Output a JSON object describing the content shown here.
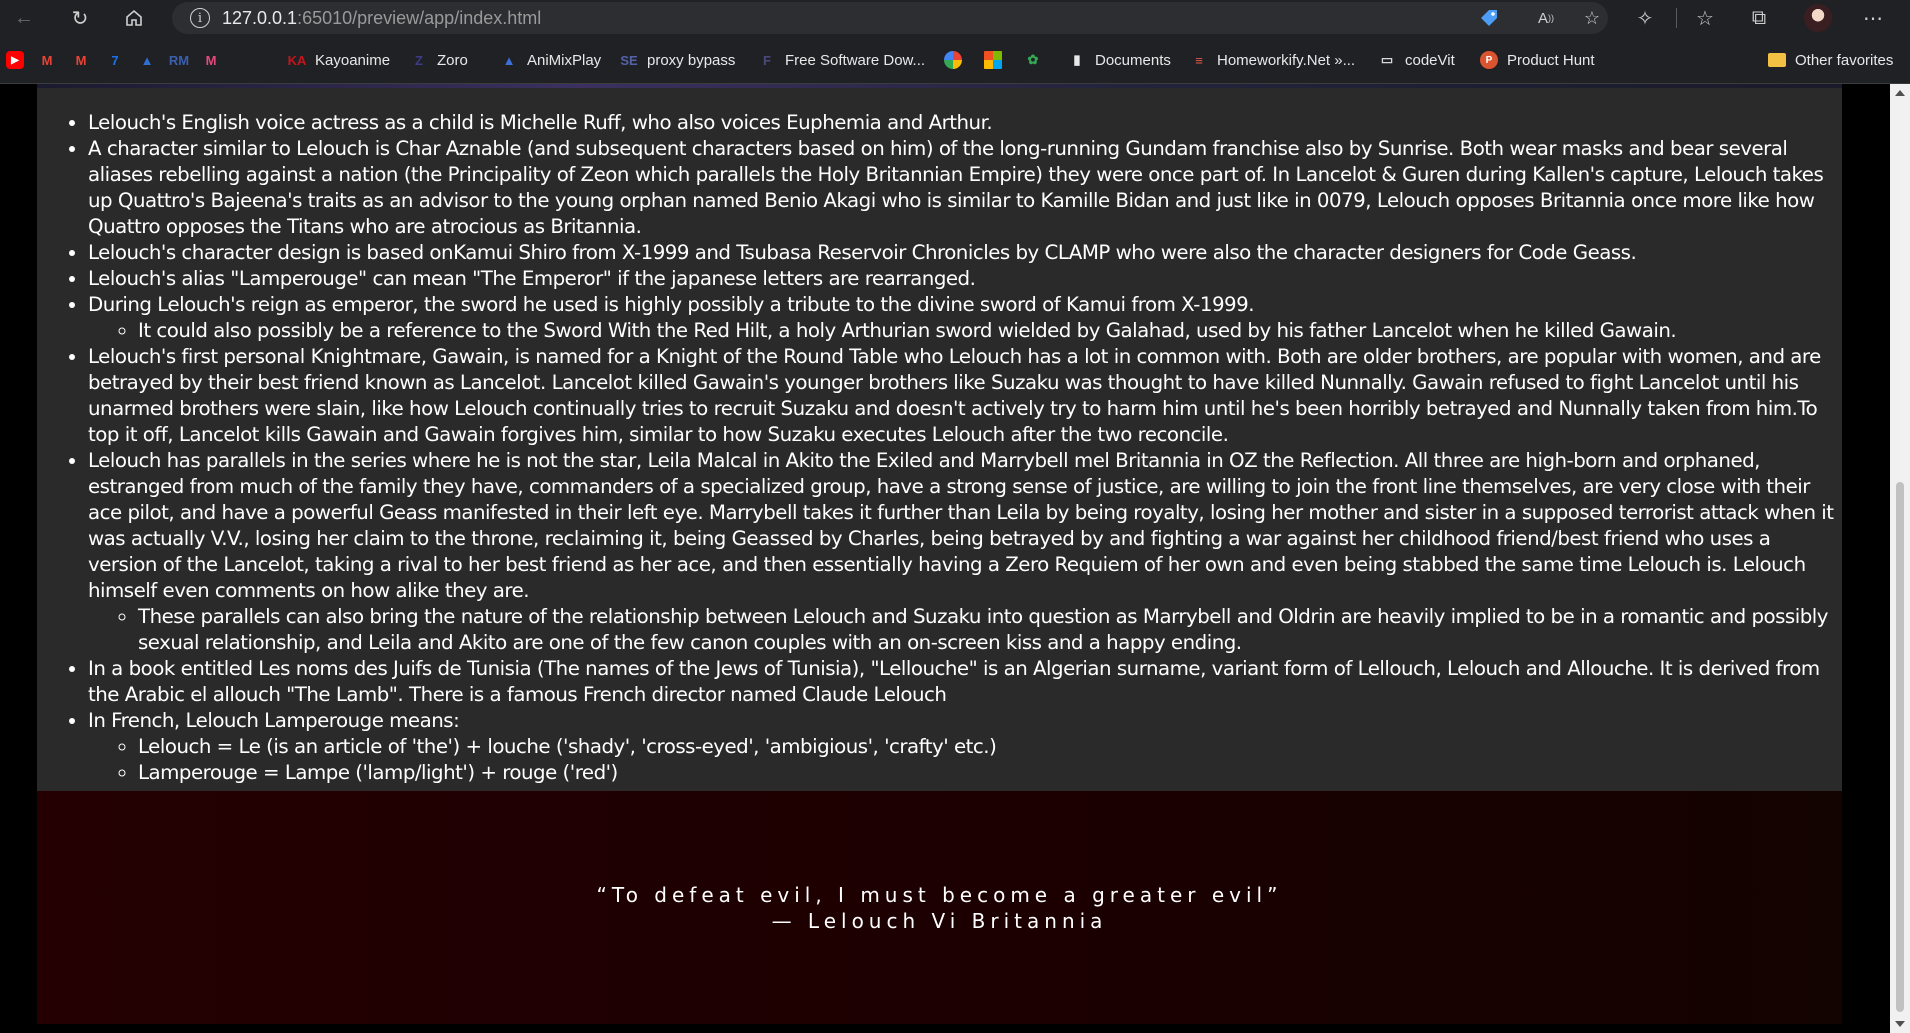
{
  "browser": {
    "url_host": "127.0.0.1",
    "url_rest": ":65010/preview/app/index.html"
  },
  "favorites": [
    {
      "label": "",
      "icon": "youtube-icon",
      "color": "#ff0000"
    },
    {
      "label": "",
      "icon": "gmail-icon",
      "color": "#ea4335"
    },
    {
      "label": "",
      "icon": "gmail-icon",
      "color": "#ea4335"
    },
    {
      "label": "",
      "icon": "calendar-icon",
      "color": "#1a73e8"
    },
    {
      "label": "",
      "icon": "triangle-app-icon",
      "color": "#2f6fd1"
    },
    {
      "label": "",
      "icon": "rm-icon",
      "color": "#3a5fb0"
    },
    {
      "label": "",
      "icon": "m-app-icon",
      "color": "#e24a7a"
    },
    {
      "label": "Kayoanime",
      "icon": "kayoanime-icon",
      "color": "#c4161c"
    },
    {
      "label": "Zoro",
      "icon": "zoro-icon",
      "color": "#3b3b8a"
    },
    {
      "label": "AniMixPlay",
      "icon": "animixplay-icon",
      "color": "#3b6fd9"
    },
    {
      "label": "proxy bypass",
      "icon": "proxy-icon",
      "color": "#5561a8"
    },
    {
      "label": "Free Software Dow...",
      "icon": "software-icon",
      "color": "#4a4a7a"
    },
    {
      "label": "",
      "icon": "google-icon",
      "color": "#ffffff"
    },
    {
      "label": "",
      "icon": "microsoft-icon",
      "color": "#f25022"
    },
    {
      "label": "",
      "icon": "photos-icon",
      "color": "#34a853"
    },
    {
      "label": "Documents",
      "icon": "document-icon",
      "color": "#e8e8e8"
    },
    {
      "label": "Homeworkify.Net »...",
      "icon": "stack-icon",
      "color": "#e05a4a"
    },
    {
      "label": "codeVit",
      "icon": "codevit-icon",
      "color": "#d8d8d8"
    },
    {
      "label": "Product Hunt",
      "icon": "product-hunt-icon",
      "color": "#da552f"
    },
    {
      "label": "Other favorites",
      "icon": "folder-icon",
      "color": "#f2c043"
    }
  ],
  "trivia": [
    {
      "text": "Lelouch's English voice actress as a child is Michelle Ruff, who also voices Euphemia and Arthur."
    },
    {
      "text": "A character similar to Lelouch is Char Aznable (and subsequent characters based on him) of the long-running Gundam franchise also by Sunrise. Both wear masks and bear several aliases rebelling against a nation (the Principality of Zeon which parallels the Holy Britannian Empire) they were once part of. In Lancelot & Guren during Kallen's capture, Lelouch takes up Quattro's Bajeena's traits as an advisor to the young orphan named Benio Akagi who is similar to Kamille Bidan and just like in 0079, Lelouch opposes Britannia once more like how Quattro opposes the Titans who are atrocious as Britannia."
    },
    {
      "text": "Lelouch's character design is based onKamui Shiro from X-1999 and Tsubasa Reservoir Chronicles by CLAMP who were also the character designers for Code Geass."
    },
    {
      "text": "Lelouch's alias \"Lamperouge\" can mean \"The Emperor\" if the japanese letters are rearranged."
    },
    {
      "text": "During Lelouch's reign as emperor, the sword he used is highly possibly a tribute to the divine sword of Kamui from X-1999.",
      "sub": [
        "It could also possibly be a reference to the Sword With the Red Hilt, a holy Arthurian sword wielded by Galahad, used by his father Lancelot when he killed Gawain."
      ]
    },
    {
      "text": "Lelouch's first personal Knightmare, Gawain, is named for a Knight of the Round Table who Lelouch has a lot in common with. Both are older brothers, are popular with women, and are betrayed by their best friend known as Lancelot. Lancelot killed Gawain's younger brothers like Suzaku was thought to have killed Nunnally. Gawain refused to fight Lancelot until his unarmed brothers were slain, like how Lelouch continually tries to recruit Suzaku and doesn't actively try to harm him until he's been horribly betrayed and Nunnally taken from him.To top it off, Lancelot kills Gawain and Gawain forgives him, similar to how Suzaku executes Lelouch after the two reconcile."
    },
    {
      "text": "Lelouch has parallels in the series where he is not the star, Leila Malcal in Akito the Exiled and Marrybell mel Britannia in OZ the Reflection. All three are high-born and orphaned, estranged from much of the family they have, commanders of a specialized group, have a strong sense of justice, are willing to join the front line themselves, are very close with their ace pilot, and have a powerful Geass manifested in their left eye. Marrybell takes it further than Leila by being royalty, losing her mother and sister in a supposed terrorist attack when it was actually V.V., losing her claim to the throne, reclaiming it, being Geassed by Charles, being betrayed by and fighting a war against her childhood friend/best friend who uses a version of the Lancelot, taking a rival to her best friend as her ace, and then essentially having a Zero Requiem of her own and even being stabbed the same time Lelouch is. Lelouch himself even comments on how alike they are.",
      "sub": [
        "These parallels can also bring the nature of the relationship between Lelouch and Suzaku into question as Marrybell and Oldrin are heavily implied to be in a romantic and possibly sexual relationship, and Leila and Akito are one of the few canon couples with an on-screen kiss and a happy ending."
      ]
    },
    {
      "text": "In a book entitled Les noms des Juifs de Tunisia (The names of the Jews of Tunisia), \"Lellouche\" is an Algerian surname, variant form of Lellouch, Lelouch and Allouche. It is derived from the Arabic el allouch \"The Lamb\". There is a famous French director named Claude Lelouch"
    },
    {
      "text": "In French, Lelouch Lamperouge means:",
      "sub": [
        "Lelouch = Le (is an article of 'the') + louche ('shady', 'cross-eyed', 'ambigious', 'crafty' etc.)",
        "Lamperouge = Lampe ('lamp/light') + rouge ('red')"
      ]
    }
  ],
  "quote": {
    "text": "“To defeat evil, I must become a greater evil”",
    "author": "— Lelouch Vi Britannia"
  }
}
